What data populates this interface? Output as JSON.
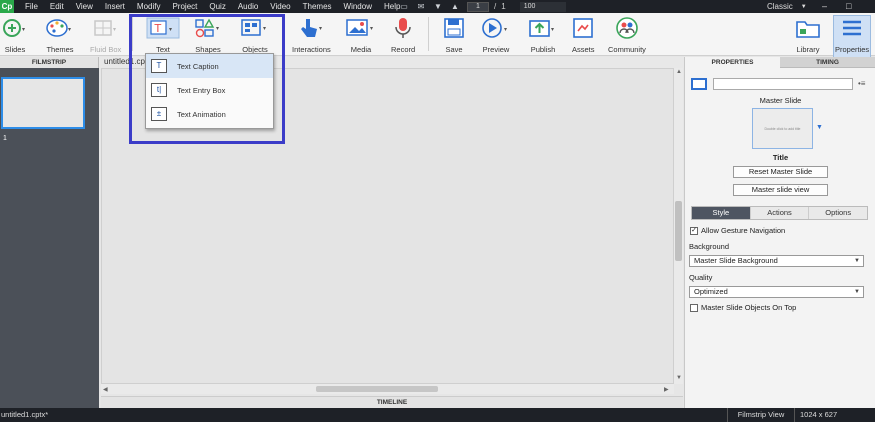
{
  "menubar": {
    "logo": "Cp",
    "items": [
      "File",
      "Edit",
      "View",
      "Insert",
      "Modify",
      "Project",
      "Quiz",
      "Audio",
      "Video",
      "Themes",
      "Window",
      "Help"
    ],
    "page_current": "1",
    "page_separator": "/",
    "page_total": "1",
    "zoom": "100",
    "workspace": "Classic",
    "window_controls": [
      "–",
      "□"
    ]
  },
  "toolbar": {
    "tools": [
      {
        "label": "Slides",
        "icon": "add-slide-icon"
      },
      {
        "label": "Themes",
        "icon": "palette-icon"
      },
      {
        "label": "Fluid Box",
        "icon": "fluid-box-icon"
      },
      {
        "label": "Text",
        "icon": "text-icon"
      },
      {
        "label": "Shapes",
        "icon": "shapes-icon"
      },
      {
        "label": "Objects",
        "icon": "objects-icon"
      },
      {
        "label": "Interactions",
        "icon": "pointer-hand-icon"
      },
      {
        "label": "Media",
        "icon": "image-icon"
      },
      {
        "label": "Record",
        "icon": "microphone-icon"
      },
      {
        "label": "Save",
        "icon": "floppy-icon"
      },
      {
        "label": "Preview",
        "icon": "play-icon"
      },
      {
        "label": "Publish",
        "icon": "publish-icon"
      },
      {
        "label": "Assets",
        "icon": "assets-icon"
      },
      {
        "label": "Community",
        "icon": "community-icon"
      },
      {
        "label": "Library",
        "icon": "folder-icon"
      },
      {
        "label": "Properties",
        "icon": "properties-icon"
      }
    ]
  },
  "text_dropdown": {
    "items": [
      {
        "label": "Text Caption",
        "icon_glyph": "T",
        "active": true
      },
      {
        "label": "Text Entry Box",
        "icon_glyph": "t|",
        "active": false
      },
      {
        "label": "Text Animation",
        "icon_glyph": "±",
        "active": false
      }
    ]
  },
  "filmstrip": {
    "header": "FILMSTRIP",
    "slide_number": "1"
  },
  "stage": {
    "tab": "untitled1.cptx*",
    "timeline_label": "TIMELINE"
  },
  "properties": {
    "tab_properties": "PROPERTIES",
    "tab_timing": "TIMING",
    "master_slide_label": "Master Slide",
    "preview_text": "Double click to add title",
    "layout_name": "Title",
    "reset_button": "Reset Master Slide",
    "view_button": "Master slide view",
    "tabs": [
      "Style",
      "Actions",
      "Options"
    ],
    "allow_gesture": "Allow Gesture Navigation",
    "background_label": "Background",
    "background_value": "Master Slide Background",
    "quality_label": "Quality",
    "quality_value": "Optimized",
    "master_objects_on_top": "Master Slide Objects On Top"
  },
  "statusbar": {
    "filename": "untitled1.cptx*",
    "view": "Filmstrip View",
    "resolution": "1024 x 627"
  },
  "colors": {
    "highlight": "#3b3cc8",
    "selection": "#2d8de8",
    "menubar": "#1e2127"
  }
}
